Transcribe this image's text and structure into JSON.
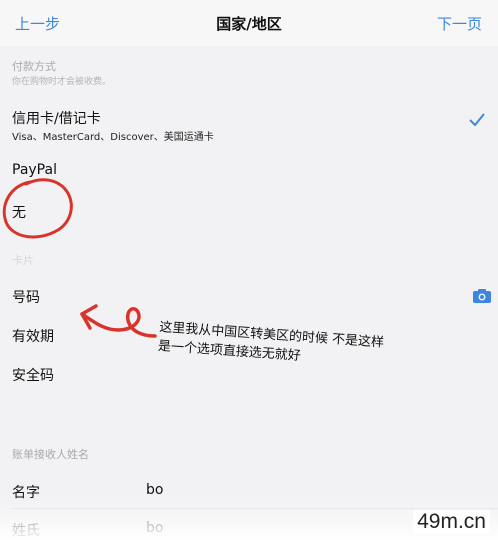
{
  "nav": {
    "back_label": "上一步",
    "title": "国家/地区",
    "next_label": "下一页"
  },
  "payment": {
    "header": "付款方式",
    "subheader": "你在购物时才会被收费。",
    "options": [
      {
        "title": "信用卡/借记卡",
        "subtitle": "Visa、MasterCard、Discover、美国运通卡",
        "selected": true
      },
      {
        "title": "PayPal",
        "subtitle": "",
        "selected": false
      },
      {
        "title": "无",
        "subtitle": "",
        "selected": false
      }
    ]
  },
  "card": {
    "faint_label": "卡片",
    "number_label": "号码",
    "expiry_label": "有效期",
    "security_label": "安全码"
  },
  "billing": {
    "header": "账单接收人姓名",
    "first_name_label": "名字",
    "first_name_value": "bo",
    "last_name_label": "姓氏",
    "last_name_value": "bo"
  },
  "annotation": {
    "text": "这里我从中国区转美区的时候 不是这样 是一个选项直接选无就好"
  },
  "watermark": "49m.cn",
  "colors": {
    "accent": "#3b86e0",
    "annotation_red": "#d9342b"
  }
}
